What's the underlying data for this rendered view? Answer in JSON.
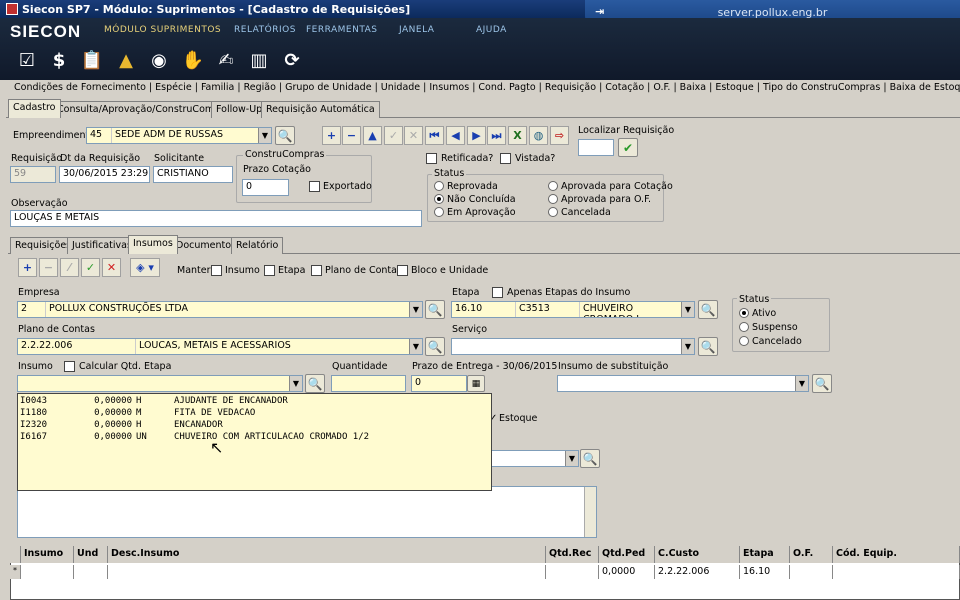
{
  "window_title": "Siecon SP7 - Módulo: Suprimentos - [Cadastro de Requisições]",
  "server": "server.pollux.eng.br",
  "logo": "SIECON",
  "menu": [
    "MÓDULO SUPRIMENTOS",
    "RELATÓRIOS",
    "FERRAMENTAS",
    "JANELA",
    "AJUDA"
  ],
  "nav_links": "Condições de Fornecimento | Espécie | Familia | Região | Grupo de Unidade | Unidade | Insumos | Cond. Pagto | Requisição | Cotação | O.F. | Baixa | Estoque | Tipo do ConstruCompras | Baixa de Estoque |",
  "main_tabs": [
    "Cadastro",
    "Consulta/Aprovação/ConstruCompras",
    "Follow-Up",
    "Requisição Automática"
  ],
  "header": {
    "empreendimento_label": "Empreendimento",
    "empreendimento_code": "45",
    "empreendimento_name": "SEDE ADM DE RUSSAS",
    "localizar_label": "Localizar Requisição",
    "requisicao_label": "Requisição",
    "requisicao_value": "59",
    "dt_label": "Dt da Requisição",
    "dt_value": "30/06/2015 23:29:14",
    "solicitante_label": "Solicitante",
    "solicitante_value": "CRISTIANO",
    "construcompras_label": "ConstruCompras",
    "prazo_label": "Prazo Cotação",
    "prazo_value": "0",
    "exportado_label": "Exportado",
    "retificada_label": "Retificada?",
    "vistada_label": "Vistada?",
    "observacao_label": "Observação",
    "observacao_value": "LOUÇAS E METAIS"
  },
  "status": {
    "label": "Status",
    "options": [
      "Reprovada",
      "Não Concluída",
      "Em Aprovação",
      "Aprovada para  Cotação",
      "Aprovada para  O.F.",
      "Cancelada"
    ],
    "selected": "Não Concluída"
  },
  "sub_tabs": [
    "Requisições",
    "Justificativas",
    "Insumos",
    "Documentos",
    "Relatório"
  ],
  "manter": {
    "label": "Manter:",
    "options": [
      "Insumo",
      "Etapa",
      "Plano de Contas",
      "Bloco e Unidade"
    ]
  },
  "insumo_form": {
    "empresa_label": "Empresa",
    "empresa_code": "2",
    "empresa_name": "POLLUX CONSTRUÇÕES LTDA",
    "etapa_label": "Etapa",
    "apenas_label": "Apenas Etapas do Insumo",
    "etapa_code": "16.10",
    "etapa_c": "C3513",
    "etapa_name": "CHUVEIRO CROMADO I",
    "plano_label": "Plano de Contas",
    "plano_code": "2.2.22.006",
    "plano_name": "LOUCAS, METAIS E ACESSARIOS",
    "servico_label": "Serviço",
    "insumo_label": "Insumo",
    "calcular_label": "Calcular Qtd. Etapa",
    "quantidade_label": "Quantidade",
    "prazo_label": "Prazo de Entrega - 30/06/2015",
    "prazo_value": "0",
    "substituicao_label": "Insumo de substituição",
    "estoque_label": "Estoque"
  },
  "status2": {
    "label": "Status",
    "options": [
      "Ativo",
      "Suspenso",
      "Cancelado"
    ],
    "selected": "Ativo"
  },
  "dropdown_rows": [
    {
      "code": "I0043",
      "qty": "0,00000",
      "unit": "H",
      "name": "AJUDANTE DE ENCANADOR"
    },
    {
      "code": "I1180",
      "qty": "0,00000",
      "unit": "M",
      "name": "FITA DE VEDACAO"
    },
    {
      "code": "I2320",
      "qty": "0,00000",
      "unit": "H",
      "name": "ENCANADOR"
    },
    {
      "code": "I6167",
      "qty": "0,00000",
      "unit": "UN",
      "name": "CHUVEIRO COM ARTICULACAO CROMADO 1/2"
    }
  ],
  "grid": {
    "columns": [
      "Insumo",
      "Und",
      "Desc.Insumo",
      "Qtd.Rec",
      "Qtd.Ped",
      "C.Custo",
      "Etapa",
      "O.F.",
      "Cód. Equip."
    ],
    "row": [
      "",
      "",
      "",
      "",
      "0,0000",
      "2.2.22.006",
      "16.10",
      "",
      ""
    ]
  }
}
